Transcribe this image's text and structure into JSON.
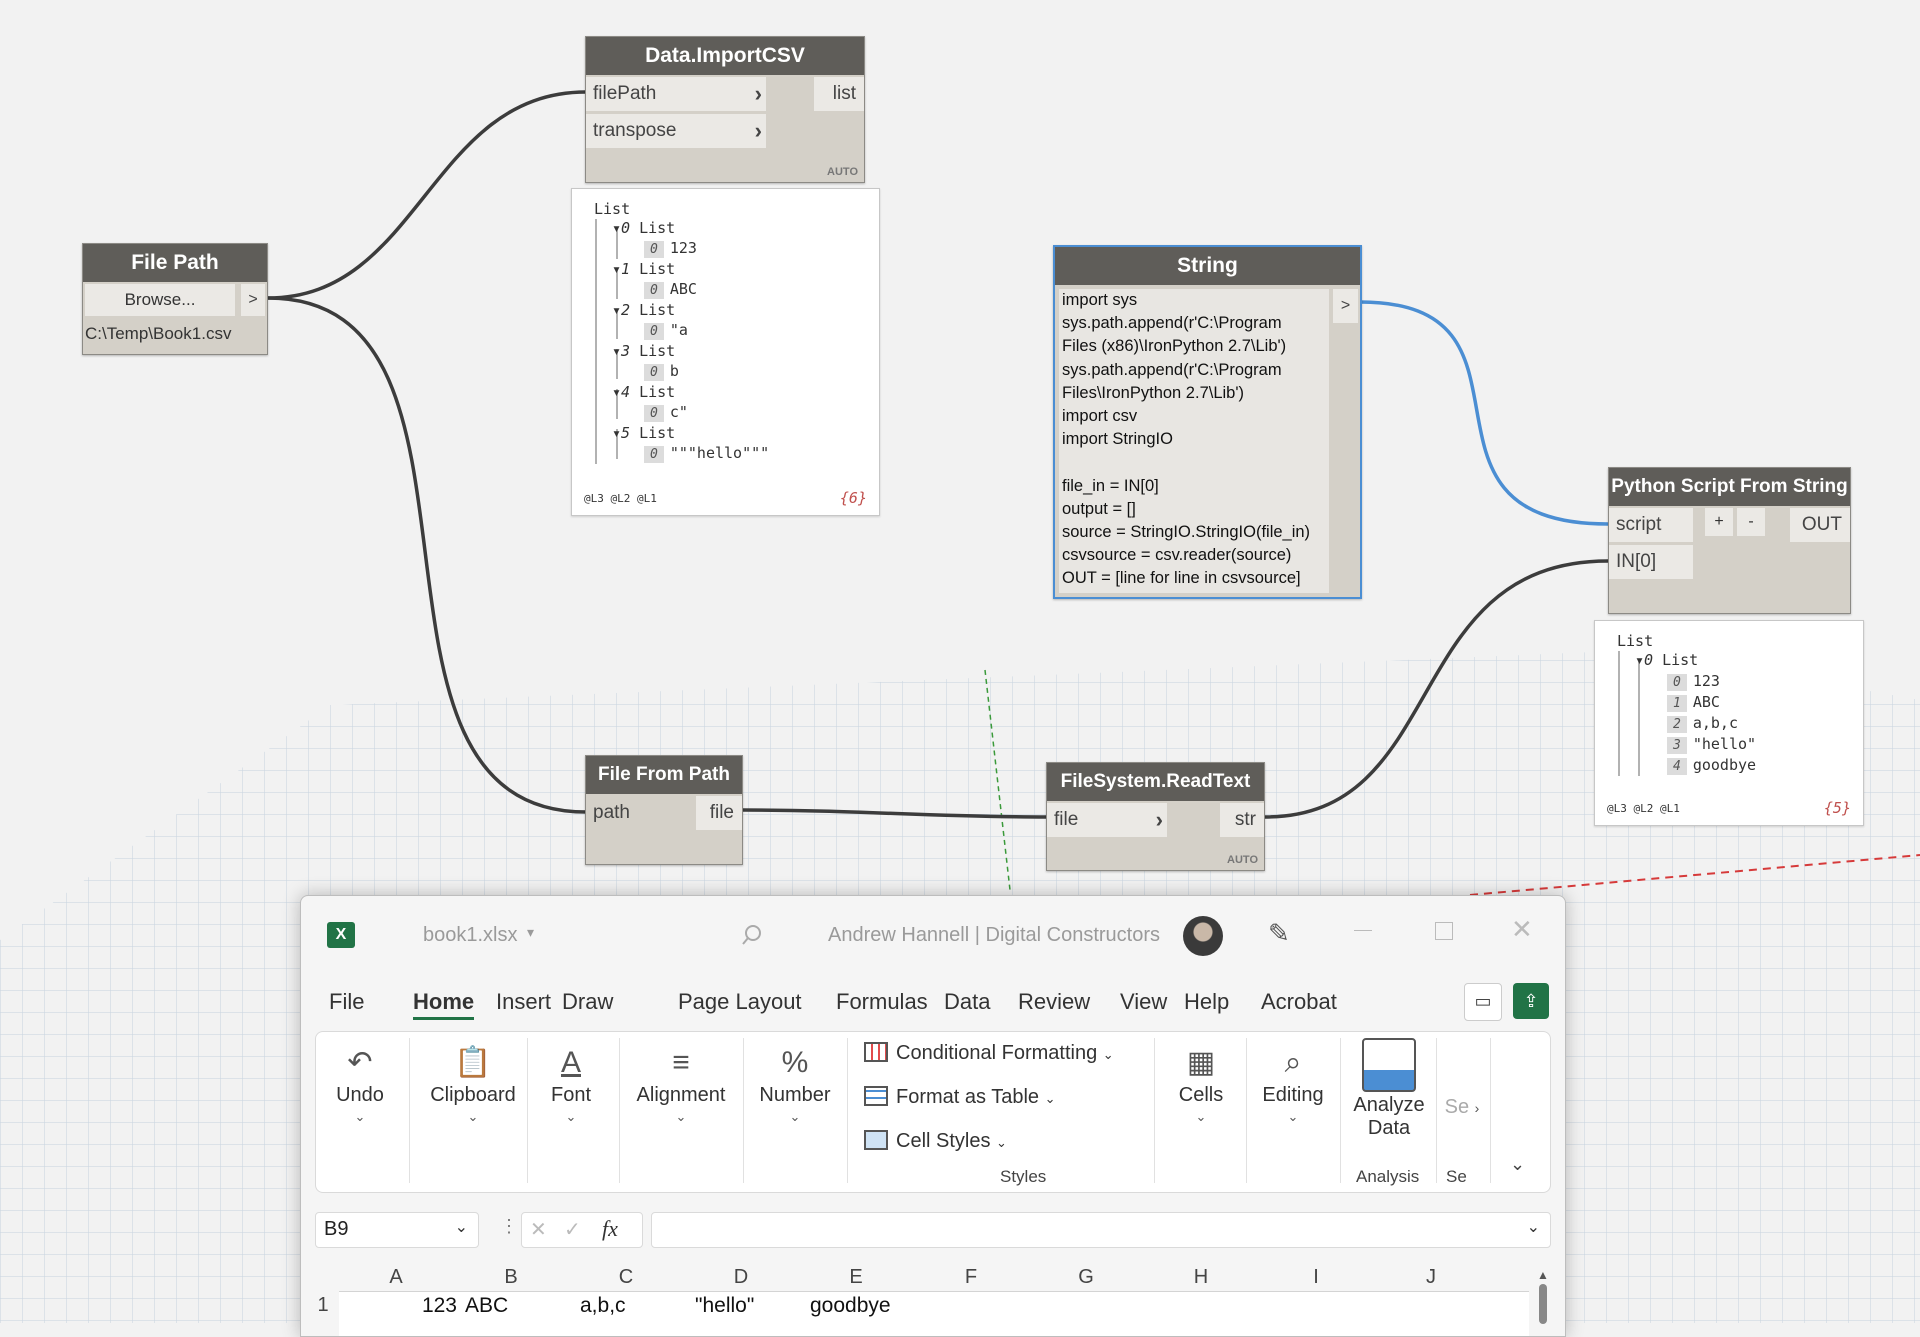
{
  "nodes": {
    "import_csv": {
      "title": "Data.ImportCSV",
      "input1": "filePath",
      "input2": "transpose",
      "output": "list",
      "mode": "AUTO"
    },
    "file_path": {
      "title": "File Path",
      "browse": "Browse...",
      "arrow": ">",
      "value": "C:\\Temp\\Book1.csv"
    },
    "string": {
      "title": "String",
      "arrow": ">",
      "code": [
        "import sys",
        "sys.path.append(r'C:\\Program",
        "Files (x86)\\IronPython 2.7\\Lib')",
        "sys.path.append(r'C:\\Program",
        "Files\\IronPython 2.7\\Lib')",
        "import csv",
        "import StringIO",
        "",
        "file_in = IN[0]",
        "output = []",
        "source = StringIO.StringIO(file_in)",
        "csvsource = csv.reader(source)",
        "OUT = [line for line in csvsource]"
      ]
    },
    "python": {
      "title": "Python Script From String",
      "input1": "script",
      "input2": "IN[0]",
      "plus": "+",
      "minus": "-",
      "output": "OUT"
    },
    "file_from_path": {
      "title": "File From Path",
      "input": "path",
      "output": "file"
    },
    "read_text": {
      "title": "FileSystem.ReadText",
      "input": "file",
      "output": "str",
      "mode": "AUTO"
    }
  },
  "preview_import": {
    "root": "List",
    "items": [
      {
        "index": "0",
        "label": "List",
        "sub_index": "0",
        "value": "123"
      },
      {
        "index": "1",
        "label": "List",
        "sub_index": "0",
        "value": "ABC"
      },
      {
        "index": "2",
        "label": "List",
        "sub_index": "0",
        "value": "\"a"
      },
      {
        "index": "3",
        "label": "List",
        "sub_index": "0",
        "value": "b"
      },
      {
        "index": "4",
        "label": "List",
        "sub_index": "0",
        "value": "c\""
      },
      {
        "index": "5",
        "label": "List",
        "sub_index": "0",
        "value": "\"\"\"hello\"\"\""
      }
    ],
    "levels": "@L3 @L2 @L1",
    "count": "{6}"
  },
  "preview_python": {
    "root": "List",
    "sub": {
      "index": "0",
      "label": "List"
    },
    "items": [
      {
        "index": "0",
        "value": "123"
      },
      {
        "index": "1",
        "value": "ABC"
      },
      {
        "index": "2",
        "value": "a,b,c"
      },
      {
        "index": "3",
        "value": "\"hello\""
      },
      {
        "index": "4",
        "value": "goodbye"
      }
    ],
    "levels": "@L3 @L2 @L1",
    "count": "{5}"
  },
  "excel": {
    "filename": "book1.xlsx",
    "user": "Andrew Hannell | Digital Constructors",
    "menu": [
      "File",
      "Home",
      "Insert",
      "Draw",
      "Page Layout",
      "Formulas",
      "Data",
      "Review",
      "View",
      "Help",
      "Acrobat"
    ],
    "active_menu": "Home",
    "ribbon": {
      "undo": "Undo",
      "clipboard": "Clipboard",
      "font": "Font",
      "alignment": "Alignment",
      "number": "Number",
      "conditional": "Conditional Formatting",
      "format_table": "Format as Table",
      "cell_styles": "Cell Styles",
      "styles_label": "Styles",
      "cells": "Cells",
      "editing": "Editing",
      "analyze_1": "Analyze",
      "analyze_2": "Data",
      "analysis_label": "Analysis",
      "se_1": "Se",
      "se_2": "Se"
    },
    "name_box": "B9",
    "fx": "fx",
    "columns": [
      "A",
      "B",
      "C",
      "D",
      "E",
      "F",
      "G",
      "H",
      "I",
      "J"
    ],
    "row_number": "1",
    "row1": [
      "123",
      "ABC",
      "a,b,c",
      "\"hello\"",
      "goodbye"
    ],
    "accent": "#217346"
  },
  "colors": {
    "wire": "#3c3c3c",
    "wire_selected": "#4b8ed3",
    "node_title": "#5f5d59",
    "node_body": "#d4d0c8"
  }
}
